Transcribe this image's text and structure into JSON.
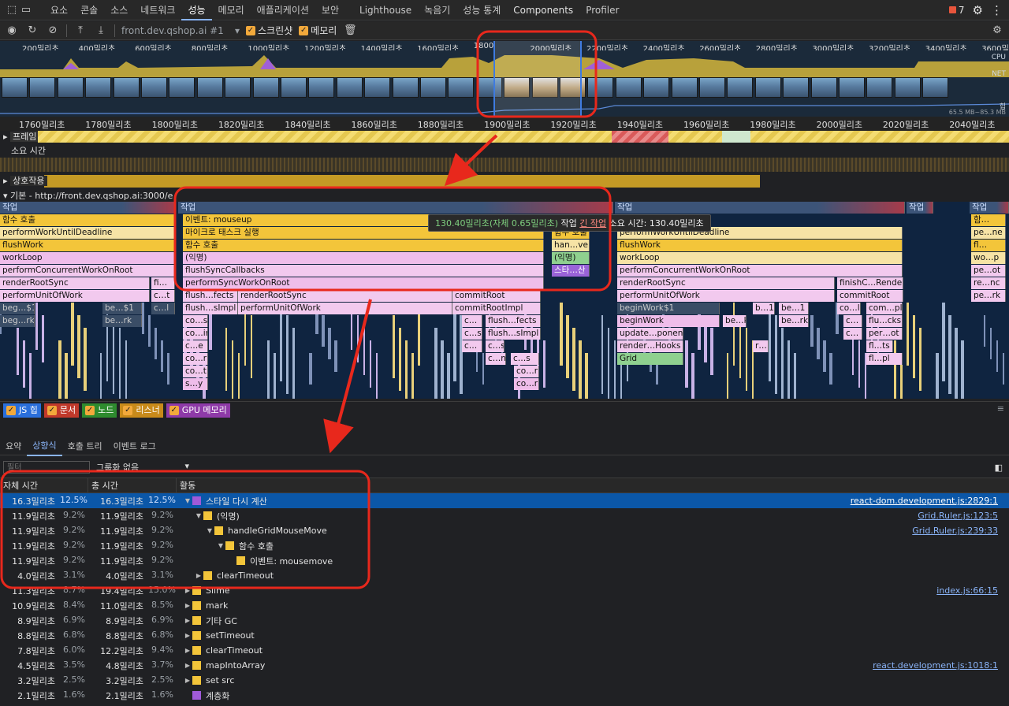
{
  "tabs": [
    {
      "label": "요소"
    },
    {
      "label": "콘솔"
    },
    {
      "label": "소스"
    },
    {
      "label": "네트워크"
    },
    {
      "label": "성능"
    },
    {
      "label": "메모리"
    },
    {
      "label": "애플리케이션"
    },
    {
      "label": "보안"
    },
    {
      "label": "Lighthouse"
    },
    {
      "label": "녹음기"
    },
    {
      "label": "성능 통계"
    },
    {
      "label": "Components"
    },
    {
      "label": "Profiler"
    }
  ],
  "active_tab": "성능",
  "issues_count": "7",
  "toolbar": {
    "profile_select": "front.dev.qshop.ai #1",
    "screenshot_label": "스크린샷",
    "memory_label": "메모리"
  },
  "overview": {
    "ruler": [
      "200밀리초",
      "400밀리초",
      "600밀리초",
      "800밀리초",
      "1000밀리초",
      "1200밀리초",
      "1400밀리초",
      "1600밀리초",
      "1800",
      "2000밀리초",
      "2200밀리초",
      "2400밀리초",
      "2600밀리초",
      "2800밀리초",
      "3000밀리초",
      "3200밀리초",
      "3400밀리초",
      "3600밀"
    ],
    "cpu_label": "CPU",
    "net_label": "NET",
    "heap_label": "힙",
    "heap_range": "65.5 MB~85.3 MB"
  },
  "ruler2": [
    "1760밀리초",
    "1780밀리초",
    "1800밀리초",
    "1820밀리초",
    "1840밀리초",
    "1860밀리초",
    "1880밀리초",
    "1900밀리초",
    "1920밀리초",
    "1940밀리초",
    "1960밀리초",
    "1980밀리초",
    "2000밀리초",
    "2020밀리초",
    "2040밀리초"
  ],
  "tracks": {
    "frames": "프레임",
    "duration": "소요 시간",
    "interactions": "상호작용",
    "main": "기본 - http://front.dev.qshop.ai:3000/e"
  },
  "flame": {
    "task": "작업",
    "col1": [
      "함수 호출",
      "performWorkUntilDeadline",
      "flushWork",
      "workLoop",
      "performConcurrentWorkOnRoot",
      "renderRootSync",
      "performUnitOfWork",
      "beg…$1",
      "beg…rk"
    ],
    "col1b": [
      "fi…",
      "c…t",
      "c…l",
      "be…$1",
      "be…rk"
    ],
    "col2": [
      "이벤트: mouseup",
      "마이크로 태스크 실행",
      "함수 호출",
      "(익명)",
      "flushSyncCallbacks",
      "performSyncWorkOnRoot",
      "flush…fects",
      "flush…sImpl",
      "co…s",
      "co…in",
      "c…e",
      "co…r",
      "co…t",
      "s…y"
    ],
    "col2b": [
      "renderRootSync",
      "performUnitOfWork",
      "commitRoot",
      "commitRootImpl",
      "c…",
      "flush…fects",
      "c…s",
      "flush…sImpl",
      "c…",
      "c…s",
      "c…n",
      "c…s",
      "co…r",
      "co…r"
    ],
    "col3": [
      "함수 호출",
      "han…ve",
      "(익명)",
      "스타…산"
    ],
    "col4": [
      "performWorkUntilDeadline",
      "flushWork",
      "workLoop",
      "performConcurrentWorkOnRoot",
      "renderRootSync",
      "performUnitOfWork",
      "beginWork$1",
      "beginWork",
      "update…ponent",
      "render…Hooks",
      "Grid"
    ],
    "col4b": [
      "finishC…Render",
      "commitRoot",
      "b…1",
      "be…1",
      "co…l",
      "com…pl",
      "be…k",
      "be…rk",
      "c…",
      "flu…cks",
      "c…",
      "per…ot",
      "r…",
      "fl…ts",
      "fl…pl"
    ],
    "col5": [
      "함…",
      "pe…ne",
      "fl…",
      "wo…p",
      "pe…ot",
      "re…nc",
      "pe…rk"
    ],
    "tooltip_time": "130.40밀리초(자체 0.65밀리초)",
    "tooltip_task": "작업",
    "tooltip_long": "긴 작업",
    "tooltip_rest": "소요 시간: 130.40밀리초"
  },
  "legend": [
    {
      "label": "JS 힙",
      "color": "#2a6fdb"
    },
    {
      "label": "문서",
      "color": "#c0392b"
    },
    {
      "label": "노드",
      "color": "#2e8b2e"
    },
    {
      "label": "리스너",
      "color": "#c88a1a"
    },
    {
      "label": "GPU 메모리",
      "color": "#8e3aa8"
    }
  ],
  "bottom_tabs": [
    {
      "label": "요약"
    },
    {
      "label": "상향식"
    },
    {
      "label": "호출 트리"
    },
    {
      "label": "이벤트 로그"
    }
  ],
  "active_bottom_tab": "상향식",
  "filter": {
    "placeholder": "필터",
    "grouping": "그룹화 없음"
  },
  "table": {
    "headers": {
      "self": "자체 시간",
      "total": "총 시간",
      "activity": "활동"
    },
    "rows": [
      {
        "self": "16.3밀리초",
        "self_pct": "12.5%",
        "total": "16.3밀리초",
        "total_pct": "12.5%",
        "indent": 0,
        "expand": "open",
        "color": "#a05ad8",
        "name": "스타일 다시 계산",
        "src": "react-dom.development.js:2829:1",
        "selected": true
      },
      {
        "self": "11.9밀리초",
        "self_pct": "9.2%",
        "total": "11.9밀리초",
        "total_pct": "9.2%",
        "indent": 1,
        "expand": "open",
        "color": "#f3c53a",
        "name": "(익명)",
        "src": "Grid.Ruler.js:123:5"
      },
      {
        "self": "11.9밀리초",
        "self_pct": "9.2%",
        "total": "11.9밀리초",
        "total_pct": "9.2%",
        "indent": 2,
        "expand": "open",
        "color": "#f3c53a",
        "name": "handleGridMouseMove",
        "src": "Grid.Ruler.js:239:33"
      },
      {
        "self": "11.9밀리초",
        "self_pct": "9.2%",
        "total": "11.9밀리초",
        "total_pct": "9.2%",
        "indent": 3,
        "expand": "open",
        "color": "#f3c53a",
        "name": "함수 호출",
        "src": ""
      },
      {
        "self": "11.9밀리초",
        "self_pct": "9.2%",
        "total": "11.9밀리초",
        "total_pct": "9.2%",
        "indent": 4,
        "expand": "none",
        "color": "#f3c53a",
        "name": "이벤트: mousemove",
        "src": ""
      },
      {
        "self": "4.0밀리초",
        "self_pct": "3.1%",
        "total": "4.0밀리초",
        "total_pct": "3.1%",
        "indent": 1,
        "expand": "closed",
        "color": "#f3c53a",
        "name": "clearTimeout",
        "src": ""
      },
      {
        "self": "11.3밀리초",
        "self_pct": "8.7%",
        "total": "19.4밀리초",
        "total_pct": "15.0%",
        "indent": 0,
        "expand": "closed",
        "color": "#f3c53a",
        "name": "Slime",
        "src": "index.js:66:15"
      },
      {
        "self": "10.9밀리초",
        "self_pct": "8.4%",
        "total": "11.0밀리초",
        "total_pct": "8.5%",
        "indent": 0,
        "expand": "closed",
        "color": "#f3c53a",
        "name": "mark",
        "src": ""
      },
      {
        "self": "8.9밀리초",
        "self_pct": "6.9%",
        "total": "8.9밀리초",
        "total_pct": "6.9%",
        "indent": 0,
        "expand": "closed",
        "color": "#f3c53a",
        "name": "기타 GC",
        "src": ""
      },
      {
        "self": "8.8밀리초",
        "self_pct": "6.8%",
        "total": "8.8밀리초",
        "total_pct": "6.8%",
        "indent": 0,
        "expand": "closed",
        "color": "#f3c53a",
        "name": "setTimeout",
        "src": ""
      },
      {
        "self": "7.8밀리초",
        "self_pct": "6.0%",
        "total": "12.2밀리초",
        "total_pct": "9.4%",
        "indent": 0,
        "expand": "closed",
        "color": "#f3c53a",
        "name": "clearTimeout",
        "src": ""
      },
      {
        "self": "4.5밀리초",
        "self_pct": "3.5%",
        "total": "4.8밀리초",
        "total_pct": "3.7%",
        "indent": 0,
        "expand": "closed",
        "color": "#f3c53a",
        "name": "mapIntoArray",
        "src": "react.development.js:1018:1"
      },
      {
        "self": "3.2밀리초",
        "self_pct": "2.5%",
        "total": "3.2밀리초",
        "total_pct": "2.5%",
        "indent": 0,
        "expand": "closed",
        "color": "#f3c53a",
        "name": "set src",
        "src": ""
      },
      {
        "self": "2.1밀리초",
        "self_pct": "1.6%",
        "total": "2.1밀리초",
        "total_pct": "1.6%",
        "indent": 0,
        "expand": "none",
        "color": "#a05ad8",
        "name": "계층화",
        "src": ""
      }
    ]
  },
  "colors": {
    "annotation": "#e8281c",
    "selected_row": "#0b57a8",
    "accent": "#8ab4f8"
  }
}
